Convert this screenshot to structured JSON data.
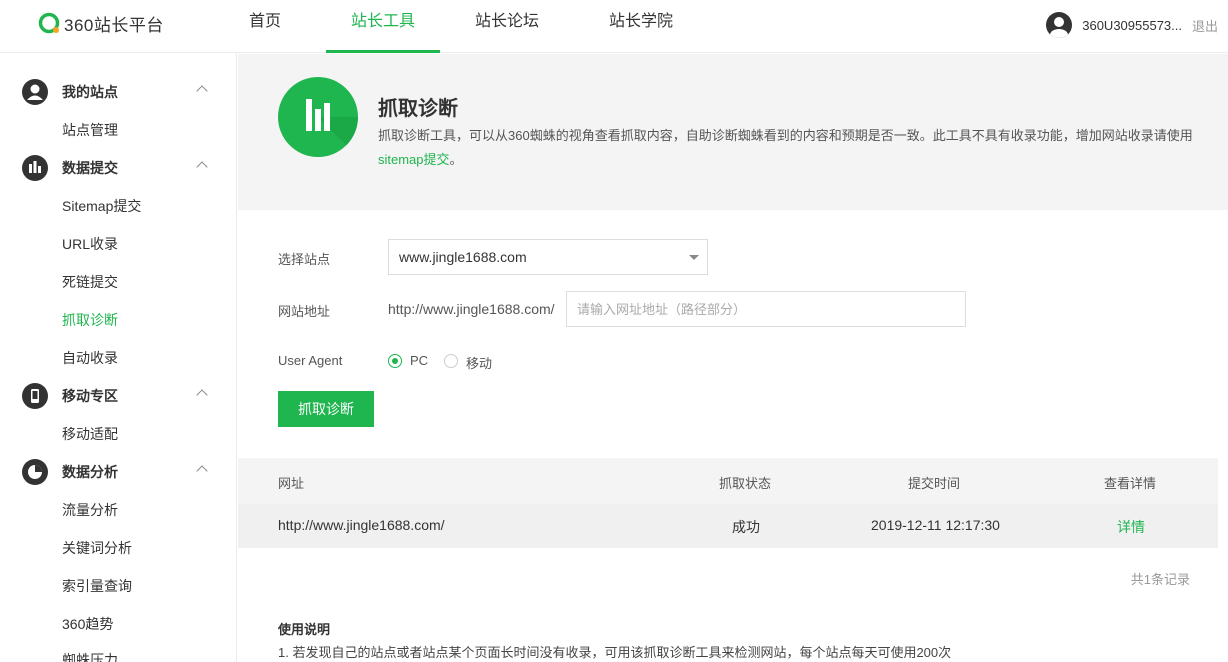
{
  "brand": {
    "name": "360站长平台",
    "accent": "#1fb54f"
  },
  "nav": {
    "items": [
      {
        "label": "首页"
      },
      {
        "label": "站长工具"
      },
      {
        "label": "站长论坛"
      },
      {
        "label": "站长学院"
      }
    ],
    "active": "站长工具"
  },
  "user": {
    "name": "360U30955573...",
    "logout": "退出"
  },
  "sidebar": {
    "groups": [
      {
        "title": "我的站点",
        "icon": "user-icon",
        "items": [
          "站点管理"
        ]
      },
      {
        "title": "数据提交",
        "icon": "bar-chart-icon",
        "items": [
          "Sitemap提交",
          "URL收录",
          "死链提交",
          "抓取诊断",
          "自动收录"
        ]
      },
      {
        "title": "移动专区",
        "icon": "mobile-icon",
        "items": [
          "移动适配"
        ]
      },
      {
        "title": "数据分析",
        "icon": "pie-chart-icon",
        "items": [
          "流量分析",
          "关键词分析",
          "索引量查询",
          "360趋势",
          "蜘蛛压力"
        ]
      }
    ],
    "active_item": "抓取诊断"
  },
  "banner": {
    "title": "抓取诊断",
    "desc": "抓取诊断工具，可以从360蜘蛛的视角查看抓取内容，自助诊断蜘蛛看到的内容和预期是否一致。此工具不具有收录功能，增加网站收录请使用",
    "link": "sitemap提交",
    "desc_end": "。"
  },
  "form": {
    "site_label": "选择站点",
    "site_value": "www.jingle1688.com",
    "url_label": "网站地址",
    "url_prefix": "http://www.jingle1688.com/",
    "url_placeholder": "请输入网址地址（路径部分）",
    "ua_label": "User Agent",
    "ua_options": [
      "PC",
      "移动"
    ],
    "ua_selected": "PC",
    "submit": "抓取诊断"
  },
  "table": {
    "headers": [
      "网址",
      "抓取状态",
      "提交时间",
      "查看详情"
    ],
    "rows": [
      {
        "url": "http://www.jingle1688.com/",
        "status": "成功",
        "time": "2019-12-11 12:17:30",
        "detail": "详情"
      }
    ],
    "count": "共1条记录"
  },
  "usage": {
    "title": "使用说明",
    "line1": "1. 若发现自己的站点或者站点某个页面长时间没有收录，可用该抓取诊断工具来检测网站，每个站点每天可使用200次"
  }
}
